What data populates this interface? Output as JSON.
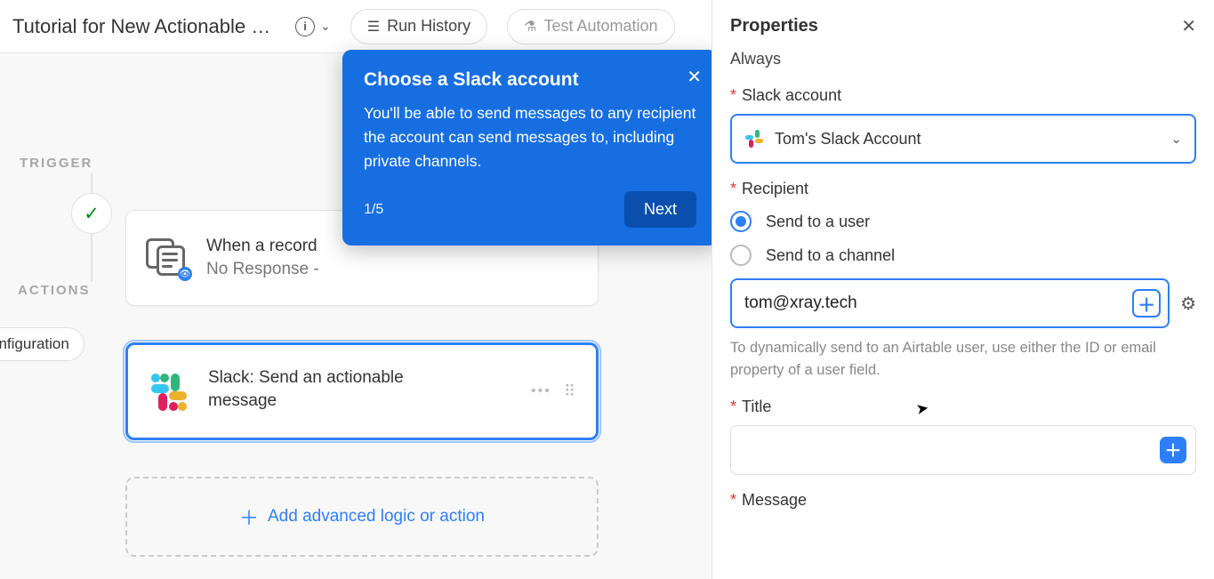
{
  "header": {
    "title": "Tutorial for New Actionable M…",
    "run_history": "Run History",
    "test_automation": "Test Automation"
  },
  "canvas": {
    "trigger_label": "TRIGGER",
    "actions_label": "ACTIONS",
    "config_pill": "onfiguration",
    "trigger_card": {
      "line1": "When a record",
      "line2": "No Response -"
    },
    "action_card": {
      "line1": "Slack: Send an actionable",
      "line2": "message"
    },
    "add_action": "Add advanced logic or action"
  },
  "popover": {
    "title": "Choose a Slack account",
    "body": "You'll be able to send messages to any recipient the account can send messages to, including private channels.",
    "step": "1/5",
    "next": "Next"
  },
  "panel": {
    "header": "Properties",
    "always": "Always",
    "slack_account_label": "Slack account",
    "slack_account_value": "Tom's Slack Account",
    "recipient_label": "Recipient",
    "radio_user": "Send to a user",
    "radio_channel": "Send to a channel",
    "recipient_value": "tom@xray.tech",
    "helper": "To dynamically send to an Airtable user, use either the ID or email property of a user field.",
    "title_label": "Title",
    "message_label": "Message"
  }
}
